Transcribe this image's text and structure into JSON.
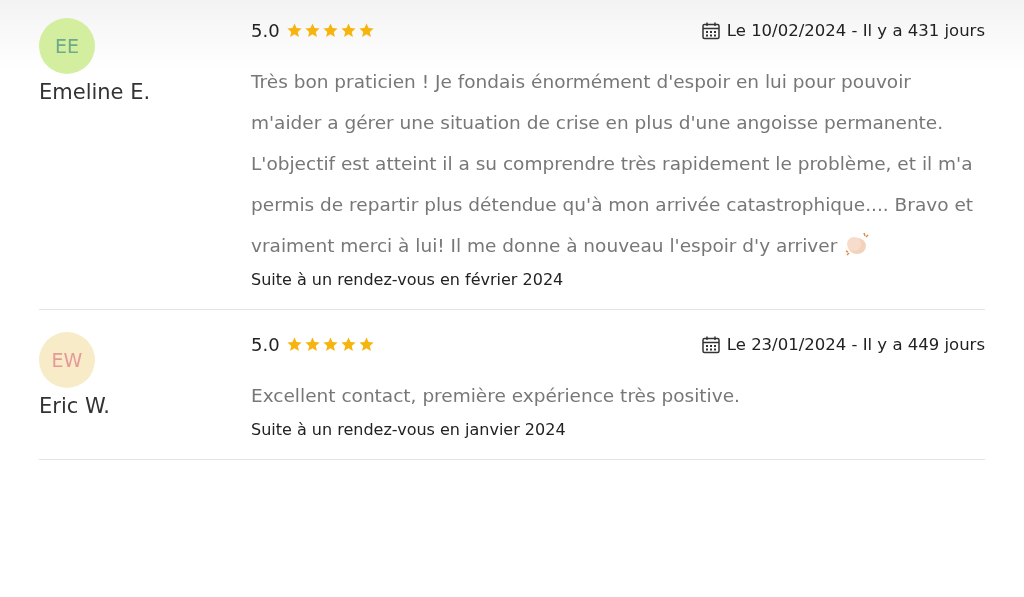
{
  "reviews": [
    {
      "avatar": {
        "color": "#d4eea0",
        "initials": {
          "text": "EE",
          "color": "#6dab8b"
        }
      },
      "name": "Emeline E.",
      "score": "5.0",
      "stars": 5,
      "date": "Le 10/02/2024 - Il y a 431 jours",
      "text": "Très bon praticien ! Je fondais énormément d'espoir en lui pour pouvoir m'aider a gérer une situation de crise en plus d'une angoisse permanente. L'objectif est atteint il a su comprendre très rapidement le problème, et il m'a permis de repartir plus détendue qu'à mon arrivée catastrophique.... Bravo et vraiment merci à lui! Il me donne à nouveau l'espoir d'y arriver",
      "clap": true,
      "visit": "Suite à un rendez-vous en février 2024"
    },
    {
      "avatar": {
        "color": "#f8ebc8",
        "initials": {
          "text": "EW",
          "color": "#e59999"
        }
      },
      "name": "Eric W.",
      "score": "5.0",
      "stars": 5,
      "date": "Le 23/01/2024 - Il y a 449 jours",
      "text": "Excellent contact, première expérience très positive.",
      "clap": false,
      "visit": "Suite à un rendez-vous en janvier 2024"
    }
  ]
}
